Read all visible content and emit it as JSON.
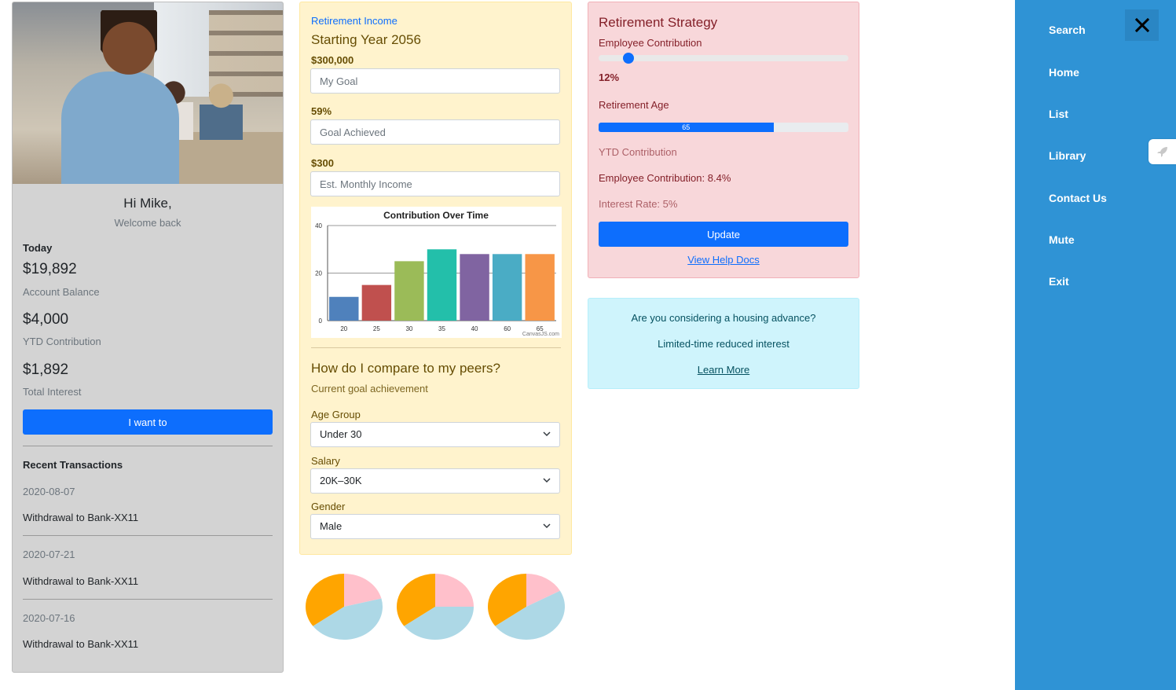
{
  "profile": {
    "greeting": "Hi Mike,",
    "welcome": "Welcome back",
    "today_label": "Today",
    "balance": "$19,892",
    "balance_label": "Account Balance",
    "ytd": "$4,000",
    "ytd_label": "YTD Contribution",
    "interest": "$1,892",
    "interest_label": "Total Interest",
    "action_button": "I want to",
    "transactions_title": "Recent Transactions",
    "transactions": [
      {
        "date": "2020-08-07",
        "desc": "Withdrawal to Bank-XX11"
      },
      {
        "date": "2020-07-21",
        "desc": "Withdrawal to Bank-XX11"
      },
      {
        "date": "2020-07-16",
        "desc": "Withdrawal to Bank-XX11"
      }
    ]
  },
  "income": {
    "link": "Retirement Income",
    "title": "Starting Year 2056",
    "goal_value": "$300,000",
    "goal_placeholder": "My Goal",
    "achieved_value": "59%",
    "achieved_placeholder": "Goal Achieved",
    "monthly_value": "$300",
    "monthly_placeholder": "Est. Monthly Income",
    "compare_title": "How do I compare to my peers?",
    "compare_sub": "Current goal achievement",
    "age_label": "Age Group",
    "age_value": "Under 30",
    "salary_label": "Salary",
    "salary_value": "20K–30K",
    "gender_label": "Gender",
    "gender_value": "Male"
  },
  "chart_data": {
    "type": "bar",
    "title": "Contribution Over Time",
    "categories": [
      "20",
      "25",
      "30",
      "35",
      "40",
      "60",
      "65"
    ],
    "values": [
      10,
      15,
      25,
      30,
      28,
      28,
      28
    ],
    "colors": [
      "#4f81bc",
      "#c0504e",
      "#9bbb58",
      "#23bfaa",
      "#8064a1",
      "#4aacc5",
      "#f79647"
    ],
    "ylim": [
      0,
      40
    ],
    "yticks": [
      "0",
      "20",
      "40"
    ],
    "credit": "CanvasJS.com",
    "grid": true
  },
  "pies": [
    {
      "slices": [
        {
          "color": "#ffc0cb",
          "value": 0.21
        },
        {
          "color": "#add8e6",
          "value": 0.44
        },
        {
          "color": "#ffa500",
          "value": 0.35
        }
      ]
    },
    {
      "slices": [
        {
          "color": "#ffc0cb",
          "value": 0.25
        },
        {
          "color": "#add8e6",
          "value": 0.4
        },
        {
          "color": "#ffa500",
          "value": 0.35
        }
      ]
    },
    {
      "slices": [
        {
          "color": "#ffc0cb",
          "value": 0.17
        },
        {
          "color": "#add8e6",
          "value": 0.48
        },
        {
          "color": "#ffa500",
          "value": 0.35
        }
      ]
    }
  ],
  "strategy": {
    "title": "Retirement Strategy",
    "contribution_label": "Employee Contribution",
    "contribution_slider_fraction": 0.12,
    "contribution_value": "12%",
    "age_label": "Retirement Age",
    "age_progress_fraction": 0.7,
    "age_value": "65",
    "ytd_label": "YTD Contribution",
    "employee_contribution": "Employee Contribution: 8.4%",
    "interest_rate": "Interest Rate: 5%",
    "update_button": "Update",
    "help_link": "View Help Docs"
  },
  "info": {
    "question": "Are you considering a housing advance?",
    "sub": "Limited-time reduced interest",
    "link": "Learn More"
  },
  "nav": {
    "items": [
      "Search",
      "Home",
      "List",
      "Library",
      "Contact Us",
      "Mute",
      "Exit"
    ],
    "accent": "#2f93d5"
  }
}
